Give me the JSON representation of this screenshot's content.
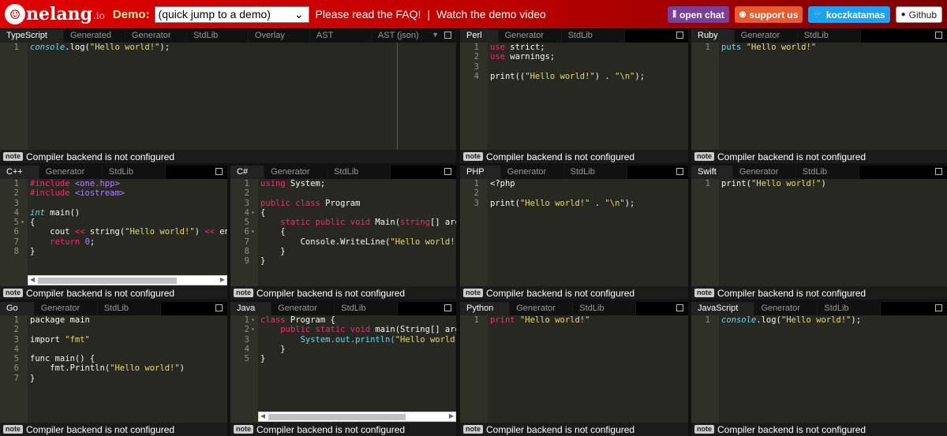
{
  "header": {
    "logo_text": "nelang",
    "logo_suffix": ".io",
    "logo_mark": "O",
    "demo_label": "Demo:",
    "demo_select": "(quick jump to a demo)",
    "faq_link": "Please read the FAQ!",
    "separator": "|",
    "video_link": "Watch the demo video",
    "buttons": [
      {
        "label": "open chat",
        "icon": "gitter-icon",
        "color": "#7b3f98"
      },
      {
        "label": "support us",
        "icon": "patreon-icon",
        "color": "#e85b2e"
      },
      {
        "label": "koczkatamas",
        "icon": "twitter-icon",
        "color": "#1da1f2"
      },
      {
        "label": "Github",
        "icon": "github-icon",
        "color": "#ffffff"
      }
    ]
  },
  "status_note": "note",
  "status_text": "Compiler backend is not configured",
  "panels": [
    {
      "id": "typescript",
      "tabs": [
        "TypeScript",
        "Generated",
        "Generator",
        "StdLib",
        "Overlay",
        "AST",
        "AST (json)"
      ],
      "dropdown": true,
      "code": [
        [
          [
            "console",
            "t"
          ],
          [
            ".log(",
            ""
          ],
          [
            "\"Hello world!\"",
            "s"
          ],
          [
            ");",
            ""
          ]
        ]
      ]
    },
    {
      "id": "perl",
      "tabs": [
        "Perl",
        "Generator",
        "StdLib"
      ],
      "code": [
        [
          [
            "use",
            "k"
          ],
          [
            " strict;",
            ""
          ]
        ],
        [
          [
            "use",
            "k"
          ],
          [
            " warnings;",
            ""
          ]
        ],
        [],
        [
          [
            "print((",
            ""
          ],
          [
            "\"Hello world!\"",
            "s"
          ],
          [
            ") . ",
            ""
          ],
          [
            "\"\\n\"",
            "s"
          ],
          [
            ");",
            ""
          ]
        ]
      ]
    },
    {
      "id": "ruby",
      "tabs": [
        "Ruby",
        "Generator",
        "StdLib"
      ],
      "code": [
        [
          [
            "puts ",
            "c"
          ],
          [
            "\"Hello world!\"",
            "s"
          ]
        ]
      ]
    },
    {
      "id": "cpp",
      "tabs": [
        "C++",
        "Generator",
        "StdLib"
      ],
      "hscroll": true,
      "folds": [
        5
      ],
      "code": [
        [
          [
            "#include",
            "k"
          ],
          [
            " <one.hpp>",
            "n"
          ]
        ],
        [
          [
            "#include",
            "k"
          ],
          [
            " <iostream>",
            "n"
          ]
        ],
        [],
        [
          [
            "int",
            "t"
          ],
          [
            " main()",
            ""
          ]
        ],
        [
          [
            "{",
            ""
          ]
        ],
        [
          [
            "    cout ",
            ""
          ],
          [
            "<<",
            "k"
          ],
          [
            " string(",
            ""
          ],
          [
            "\"Hello world!\"",
            "s"
          ],
          [
            ") ",
            ""
          ],
          [
            "<<",
            "k"
          ],
          [
            " endl;",
            ""
          ]
        ],
        [
          [
            "    ",
            ""
          ],
          [
            "return",
            "k"
          ],
          [
            " ",
            ""
          ],
          [
            "0",
            "n"
          ],
          [
            ";",
            ""
          ]
        ],
        [
          [
            "}",
            ""
          ]
        ]
      ]
    },
    {
      "id": "csharp",
      "tabs": [
        "C#",
        "Generator",
        "StdLib"
      ],
      "folds": [
        4,
        6
      ],
      "code": [
        [
          [
            "using",
            "k"
          ],
          [
            " System;",
            ""
          ]
        ],
        [],
        [
          [
            "public class",
            "k"
          ],
          [
            " Program",
            ""
          ]
        ],
        [
          [
            "{",
            ""
          ]
        ],
        [
          [
            "    ",
            ""
          ],
          [
            "static public void",
            "k"
          ],
          [
            " Main(",
            ""
          ],
          [
            "string",
            "k"
          ],
          [
            "[] args)",
            ""
          ]
        ],
        [
          [
            "    {",
            ""
          ]
        ],
        [
          [
            "        Console.WriteLine(",
            ""
          ],
          [
            "\"Hello world!\"",
            "s"
          ],
          [
            ");",
            ""
          ]
        ],
        [
          [
            "    }",
            ""
          ]
        ],
        [
          [
            "}",
            ""
          ]
        ]
      ]
    },
    {
      "id": "php",
      "tabs": [
        "PHP",
        "Generator",
        "StdLib"
      ],
      "code": [
        [
          [
            "<?php",
            ""
          ]
        ],
        [],
        [
          [
            "print(",
            ""
          ],
          [
            "\"Hello world!\"",
            "s"
          ],
          [
            " . ",
            ""
          ],
          [
            "\"\\n\"",
            "s"
          ],
          [
            ");",
            ""
          ]
        ]
      ]
    },
    {
      "id": "swift",
      "tabs": [
        "Swift",
        "Generator",
        "StdLib"
      ],
      "code": [
        [
          [
            "print(",
            ""
          ],
          [
            "\"Hello world!\"",
            "s"
          ],
          [
            ")",
            ""
          ]
        ]
      ]
    },
    {
      "id": "go",
      "tabs": [
        "Go",
        "Generator",
        "StdLib"
      ],
      "code": [
        [
          [
            "package main",
            ""
          ]
        ],
        [],
        [
          [
            "import ",
            ""
          ],
          [
            "\"fmt\"",
            "s"
          ]
        ],
        [],
        [
          [
            "func main() {",
            ""
          ]
        ],
        [
          [
            "    fmt.Println(",
            ""
          ],
          [
            "\"Hello world!\"",
            "s"
          ],
          [
            ")",
            ""
          ]
        ],
        [
          [
            "}",
            ""
          ]
        ]
      ]
    },
    {
      "id": "java",
      "tabs": [
        "Java",
        "Generator",
        "StdLib"
      ],
      "hscroll": true,
      "folds": [
        1,
        2
      ],
      "code": [
        [
          [
            "class",
            "k"
          ],
          [
            " Program {",
            ""
          ]
        ],
        [
          [
            "    ",
            ""
          ],
          [
            "public static void",
            "k"
          ],
          [
            " main(String[] args)",
            ""
          ]
        ],
        [
          [
            "        ",
            ""
          ],
          [
            "System.out.println(",
            "c"
          ],
          [
            "\"Hello world!\"",
            "s"
          ],
          [
            ");",
            ""
          ]
        ],
        [
          [
            "    }",
            ""
          ]
        ],
        [
          [
            "}",
            ""
          ]
        ]
      ]
    },
    {
      "id": "python",
      "tabs": [
        "Python",
        "Generator",
        "StdLib"
      ],
      "code": [
        [
          [
            "print",
            "k"
          ],
          [
            " ",
            ""
          ],
          [
            "\"Hello world!\"",
            "s"
          ]
        ]
      ]
    },
    {
      "id": "javascript",
      "tabs": [
        "JavaScript",
        "Generator",
        "StdLib"
      ],
      "code": [
        [
          [
            "console",
            "t"
          ],
          [
            ".log(",
            ""
          ],
          [
            "\"Hello world!\"",
            "s"
          ],
          [
            ");",
            ""
          ]
        ]
      ]
    }
  ]
}
